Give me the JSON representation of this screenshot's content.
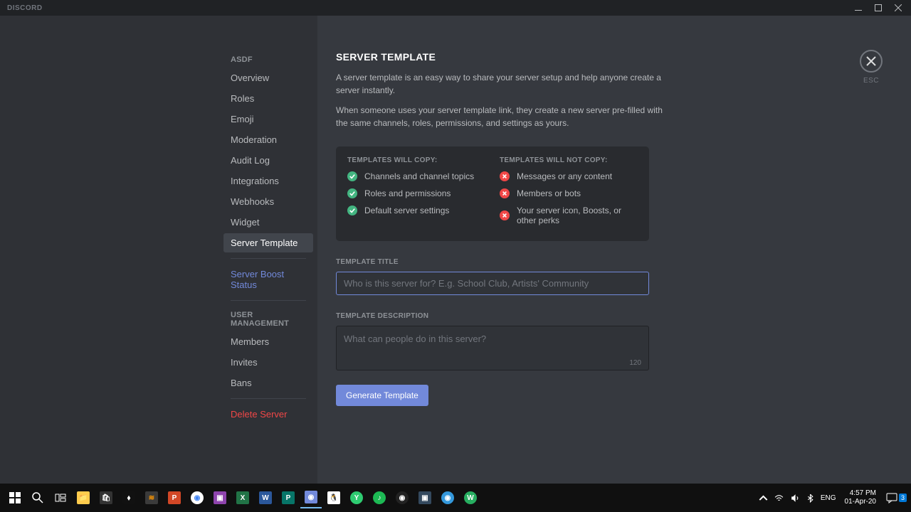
{
  "titlebar": {
    "app_name": "DISCORD"
  },
  "sidebar": {
    "server_name": "ASDF",
    "items": [
      "Overview",
      "Roles",
      "Emoji",
      "Moderation",
      "Audit Log",
      "Integrations",
      "Webhooks",
      "Widget",
      "Server Template"
    ],
    "boost_label": "Server Boost Status",
    "user_mgmt_header": "USER MANAGEMENT",
    "user_mgmt_items": [
      "Members",
      "Invites",
      "Bans"
    ],
    "delete_label": "Delete Server"
  },
  "content": {
    "title": "SERVER TEMPLATE",
    "esc_label": "ESC",
    "desc1": "A server template is an easy way to share your server setup and help anyone create a server instantly.",
    "desc2": "When someone uses your server template link, they create a new server pre-filled with the same channels, roles, permissions, and settings as yours.",
    "will_copy_header": "TEMPLATES WILL COPY:",
    "will_copy_items": [
      "Channels and channel topics",
      "Roles and permissions",
      "Default server settings"
    ],
    "wont_copy_header": "TEMPLATES WILL NOT COPY:",
    "wont_copy_items": [
      "Messages or any content",
      "Members or bots",
      "Your server icon, Boosts, or other perks"
    ],
    "title_label": "TEMPLATE TITLE",
    "title_placeholder": "Who is this server for? E.g. School Club, Artists' Community",
    "desc_label": "TEMPLATE DESCRIPTION",
    "desc_placeholder": "What can people do in this server?",
    "char_count": "120",
    "generate_label": "Generate Template"
  },
  "taskbar": {
    "lang": "ENG",
    "time": "4:57 PM",
    "date": "01-Apr-20",
    "notif_count": "3"
  }
}
